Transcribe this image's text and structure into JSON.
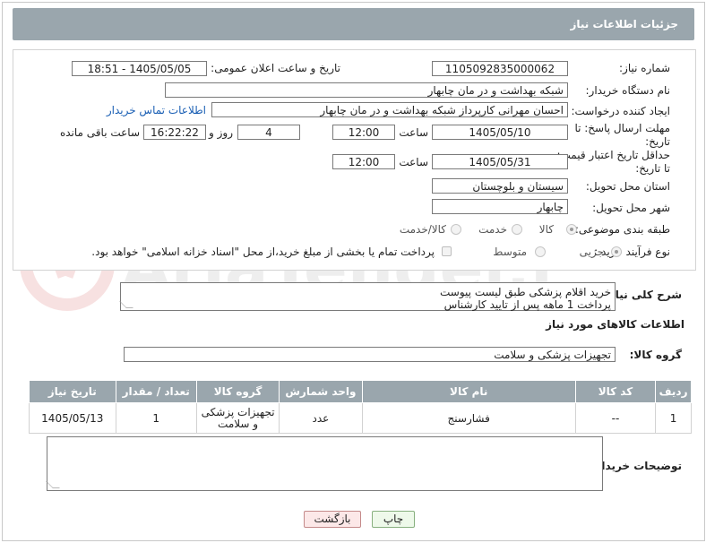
{
  "header": {
    "title": "جزئیات اطلاعات نیاز"
  },
  "watermark": {
    "text": "AriaTender.net"
  },
  "fields": {
    "need_number": {
      "label": "شماره نیاز:",
      "value": "1105092835000062"
    },
    "announce_datetime": {
      "label": "تاریخ و ساعت اعلان عمومی:",
      "value": "1405/05/05 - 18:51"
    },
    "buyer_org": {
      "label": "نام دستگاه خریدار:",
      "value": "شبکه بهداشت و در مان چابهار"
    },
    "requester": {
      "label": "ایجاد کننده درخواست:",
      "value": "احسان مهرانی کارپرداز شبکه بهداشت و در مان چابهار"
    },
    "buyer_contact_link": "اطلاعات تماس خریدار",
    "reply_deadline": {
      "label": "مهلت ارسال پاسخ: تا تاریخ:",
      "date": "1405/05/10",
      "time_label": "ساعت",
      "time": "12:00",
      "days": "4",
      "days_label": "روز و",
      "remaining": "16:22:22",
      "remaining_label": "ساعت باقی مانده"
    },
    "price_validity": {
      "label": "حداقل تاریخ اعتبار قیمت: تا تاریخ:",
      "date": "1405/05/31",
      "time_label": "ساعت",
      "time": "12:00"
    },
    "delivery_province": {
      "label": "استان محل تحویل:",
      "value": "سیستان و بلوچستان"
    },
    "delivery_city": {
      "label": "شهر محل تحویل:",
      "value": "چابهار"
    },
    "category": {
      "label": "طبقه بندی موضوعی:",
      "options": [
        "کالا",
        "خدمت",
        "کالا/خدمت"
      ],
      "selected": "کالا"
    },
    "purchase_type": {
      "label": "نوع فرآیند خرید :",
      "options": [
        "جزیی",
        "متوسط"
      ],
      "selected": "جزیی",
      "treasury_note": "پرداخت تمام یا بخشی از مبلغ خرید،از محل \"اسناد خزانه اسلامی\" خواهد بود."
    }
  },
  "description": {
    "label": "شرح کلی نیاز:",
    "line1": "خرید اقلام پزشکی طبق لیست پیوست",
    "line2": "پرداخت 1 ماهه پس از تایید کارشناس"
  },
  "goods_info": {
    "title": "اطلاعات کالاهای مورد نیاز",
    "group_label": "گروه کالا:",
    "group_value": "تجهیزات پزشکی و سلامت"
  },
  "table": {
    "headers": [
      "ردیف",
      "کد کالا",
      "نام کالا",
      "واحد شمارش",
      "گروه کالا",
      "تعداد / مقدار",
      "تاریخ نیاز"
    ],
    "rows": [
      [
        "1",
        "--",
        "فشارسنج",
        "عدد",
        "تجهیزات پزشکی و سلامت",
        "1",
        "1405/05/13"
      ]
    ]
  },
  "buyer_notes": {
    "label": "توضیحات خریدار:"
  },
  "buttons": {
    "print": "چاپ",
    "back": "بازگشت"
  },
  "colors": {
    "header_bg": "#9aa6ad",
    "link": "#1a5fb4"
  }
}
